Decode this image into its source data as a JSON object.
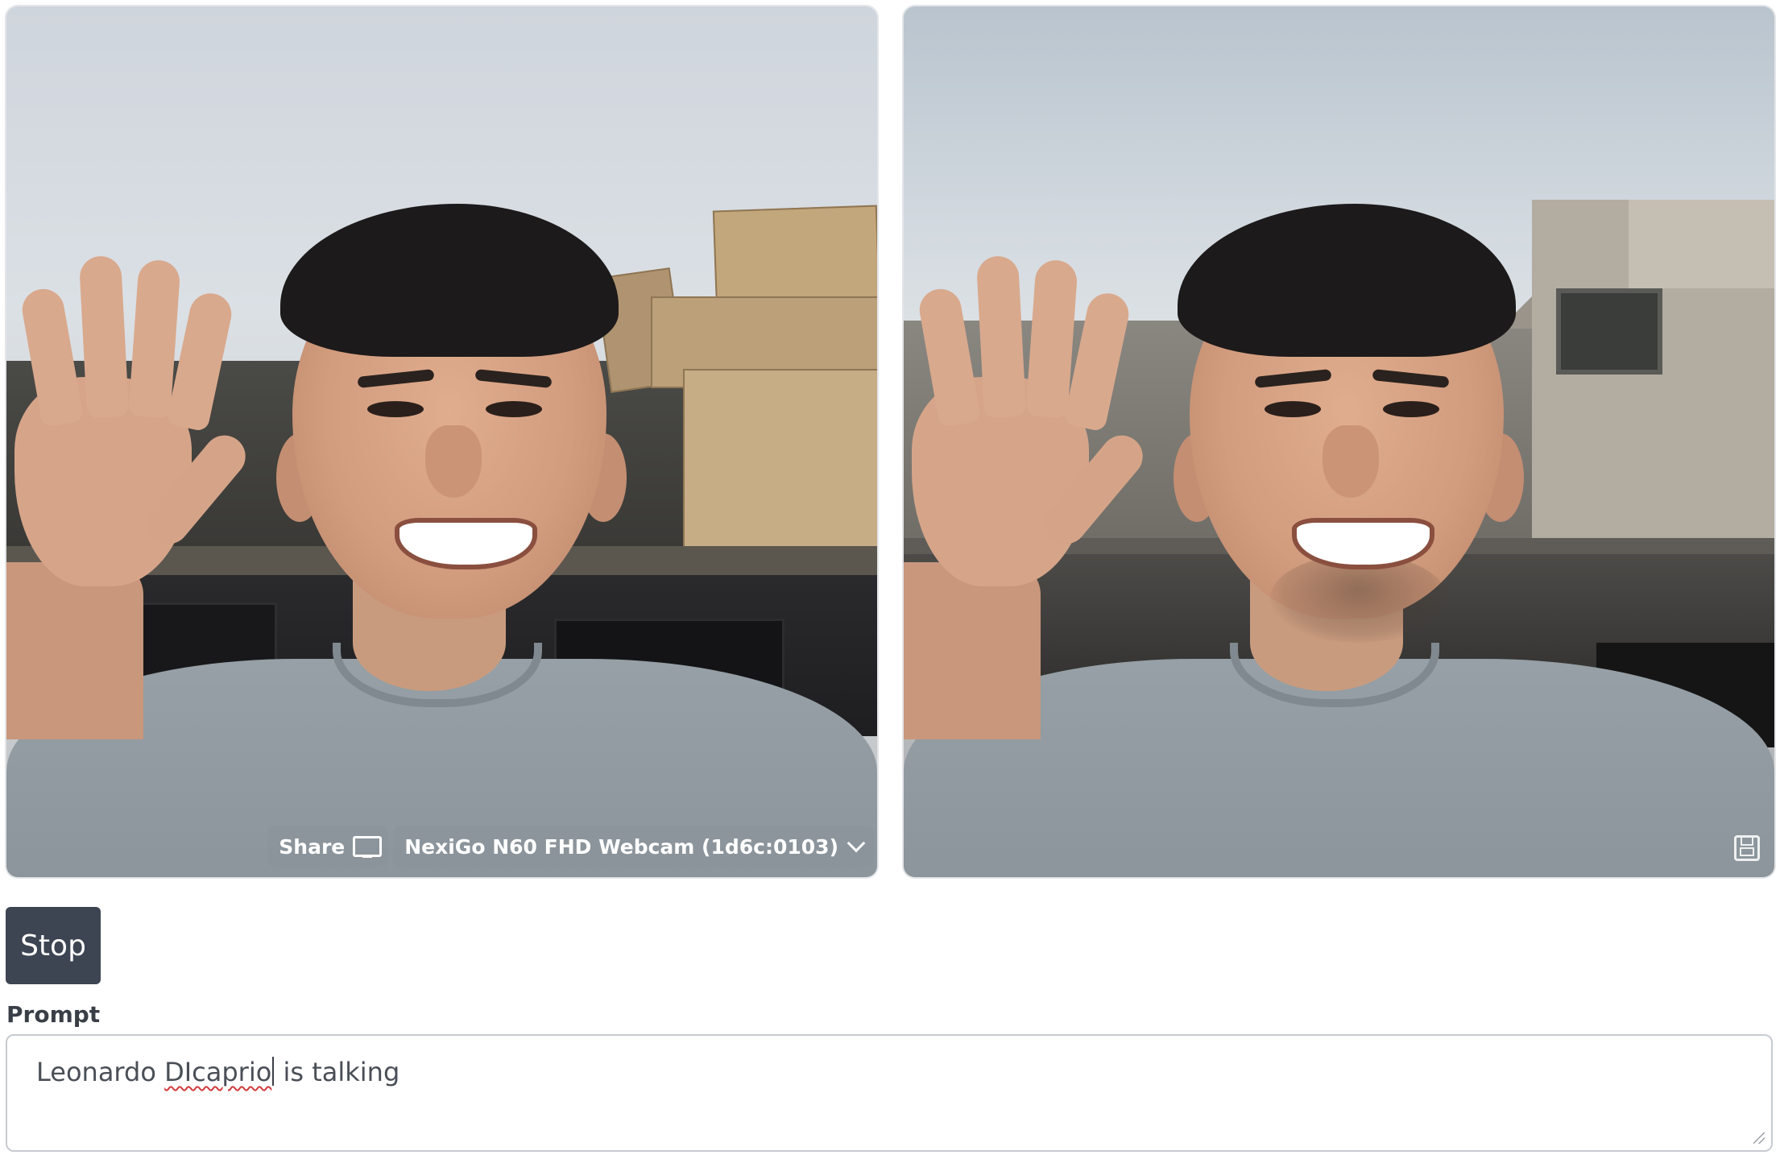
{
  "video_panels": {
    "input": {
      "share_label": "Share",
      "share_icon": "monitor-icon",
      "device_label": "NexiGo N60 FHD Webcam (1d6c:0103)",
      "device_dropdown_icon": "chevron-down-icon"
    },
    "output": {
      "save_icon": "save-icon"
    }
  },
  "controls": {
    "stop_label": "Stop",
    "prompt_label": "Prompt",
    "prompt_value": {
      "before": "Leonardo ",
      "misspelled_a": "DIcaprio",
      "misspelled_b": "o",
      "after": " is talking",
      "full": "Leonardo DIcaprio is talking"
    }
  },
  "colors": {
    "button_bg": "#3d4452",
    "button_text": "#ffffff",
    "input_border": "#c7cbd1",
    "spellcheck_underline": "#d23b3b"
  }
}
